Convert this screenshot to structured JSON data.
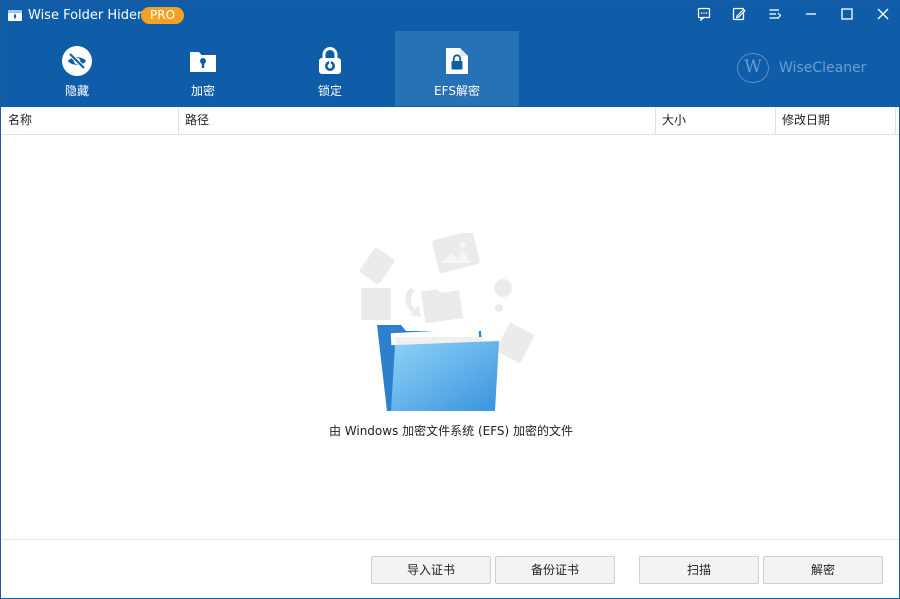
{
  "app": {
    "title": "Wise Folder Hider",
    "badge": "PRO",
    "brand": "WiseCleaner",
    "brand_mark": "W"
  },
  "window_controls": [
    {
      "icon": "feedback-icon"
    },
    {
      "icon": "edit-icon"
    },
    {
      "icon": "menu-icon"
    },
    {
      "icon": "minimize-icon"
    },
    {
      "icon": "maximize-icon"
    },
    {
      "icon": "close-icon"
    }
  ],
  "tabs": [
    {
      "label": "隐藏",
      "icon": "eye-slash-icon",
      "active": false
    },
    {
      "label": "加密",
      "icon": "folder-keyhole-icon",
      "active": false
    },
    {
      "label": "锁定",
      "icon": "padlock-icon",
      "active": false
    },
    {
      "label": "EFS解密",
      "icon": "file-lock-icon",
      "active": true
    }
  ],
  "table": {
    "columns": [
      "名称",
      "路径",
      "大小",
      "修改日期"
    ],
    "rows": []
  },
  "empty_state": {
    "message": "由 Windows 加密文件系统 (EFS) 加密的文件"
  },
  "buttons": {
    "import_cert": "导入证书",
    "backup_cert": "备份证书",
    "scan": "扫描",
    "decrypt": "解密"
  },
  "colors": {
    "header_bg": "#0f5da8",
    "active_tab_bg": "#2771b6",
    "badge_bg": "#f2a326",
    "folder_blue": "#3a93de"
  }
}
